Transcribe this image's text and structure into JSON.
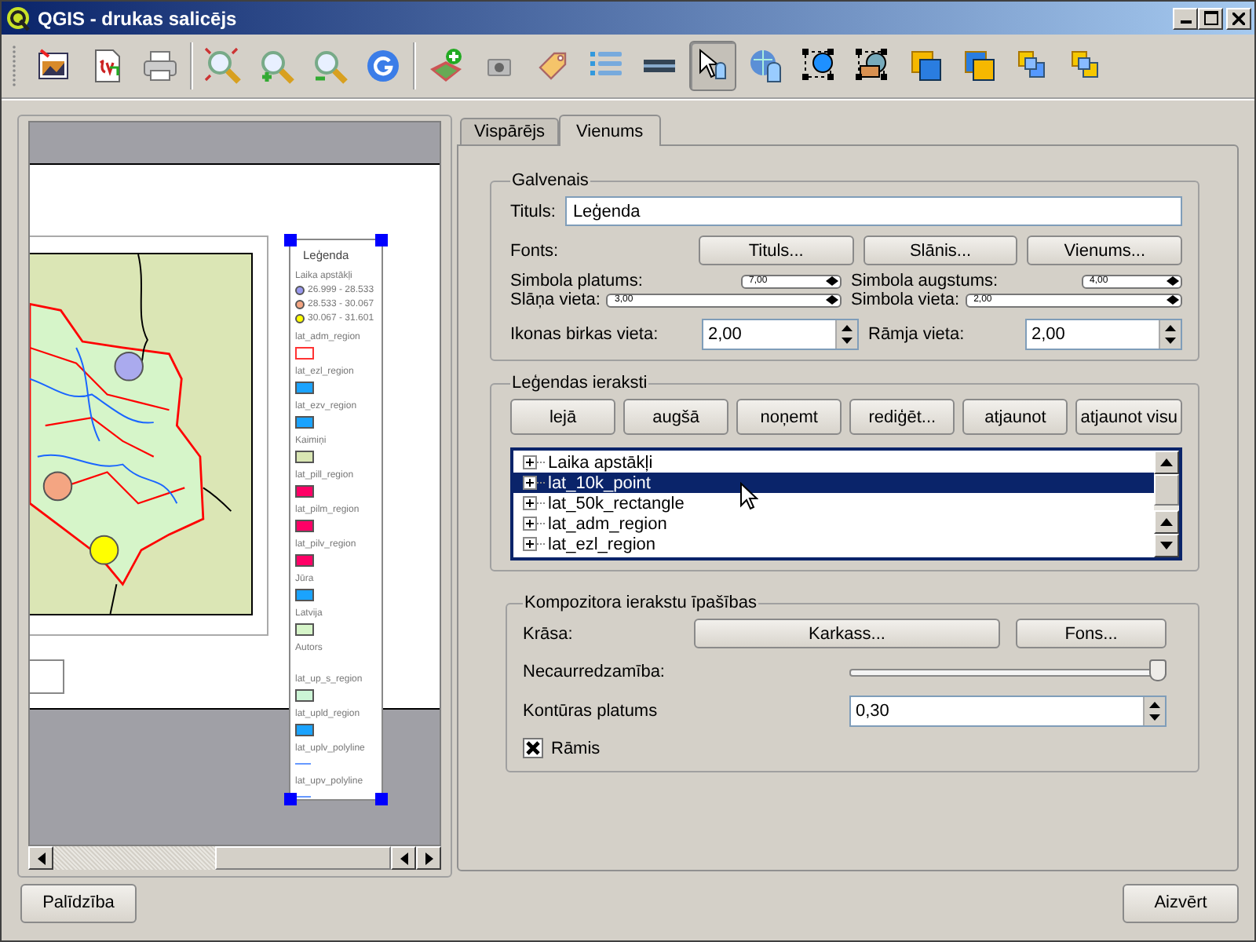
{
  "window": {
    "title": "QGIS - drukas salicējs"
  },
  "toolbar": [
    {
      "kind": "image",
      "selected": false
    },
    {
      "kind": "svg",
      "selected": false
    },
    {
      "kind": "print",
      "selected": false
    },
    {
      "kind": "zoomfull",
      "selected": false
    },
    {
      "kind": "zoomin",
      "selected": false
    },
    {
      "kind": "zoomout",
      "selected": false
    },
    {
      "kind": "refresh",
      "selected": false
    },
    {
      "kind": "addmap",
      "selected": false
    },
    {
      "kind": "camera",
      "selected": false
    },
    {
      "kind": "tag",
      "selected": false
    },
    {
      "kind": "list",
      "selected": false
    },
    {
      "kind": "scalebar",
      "selected": false
    },
    {
      "kind": "select",
      "selected": true
    },
    {
      "kind": "pan",
      "selected": false
    },
    {
      "kind": "shape",
      "selected": false
    },
    {
      "kind": "shape2",
      "selected": false
    },
    {
      "kind": "raise",
      "selected": false
    },
    {
      "kind": "lower",
      "selected": false
    },
    {
      "kind": "group",
      "selected": false
    },
    {
      "kind": "ungroup",
      "selected": false
    }
  ],
  "composer": {
    "legend": {
      "title": "Leģenda",
      "group": "Laika apstākļi",
      "classes": [
        {
          "label": "26.999 - 28.533",
          "color": "#9999ee"
        },
        {
          "label": "28.533 - 30.067",
          "color": "#f4a582"
        },
        {
          "label": "30.067 - 31.601",
          "color": "#ffff00"
        }
      ],
      "layers": [
        {
          "name": "lat_adm_region",
          "kind": "outline",
          "color": "#ff3333"
        },
        {
          "name": "lat_ezl_region",
          "kind": "fill",
          "color": "#1aa3ff"
        },
        {
          "name": "lat_ezv_region",
          "kind": "fill",
          "color": "#1aa3ff"
        },
        {
          "name": "Kaimiņi",
          "kind": "fill",
          "color": "#d9e6b3"
        },
        {
          "name": "lat_pill_region",
          "kind": "fill",
          "color": "#ff0066"
        },
        {
          "name": "lat_pilm_region",
          "kind": "fill",
          "color": "#ff0066"
        },
        {
          "name": "lat_pilv_region",
          "kind": "fill",
          "color": "#ff0066"
        },
        {
          "name": "Jūra",
          "kind": "fill",
          "color": "#1aa3ff"
        },
        {
          "name": "Latvija",
          "kind": "fill",
          "color": "#d6f5c9"
        },
        {
          "name": "Autors",
          "kind": "text"
        },
        {
          "name": "lat_up_s_region",
          "kind": "fill",
          "color": "#ccf5d6"
        },
        {
          "name": "lat_upld_region",
          "kind": "fill",
          "color": "#1aa3ff"
        },
        {
          "name": "lat_uplv_polyline",
          "kind": "line",
          "color": "#6699ff"
        },
        {
          "name": "lat_upv_polyline",
          "kind": "line",
          "color": "#6699ff"
        }
      ]
    }
  },
  "tabs": [
    {
      "label": "Vispārējs",
      "selected": false
    },
    {
      "label": "Vienums",
      "selected": true
    }
  ],
  "main_group": {
    "title": "Galvenais",
    "title_label": "Tituls:",
    "title_value": "Leģenda",
    "fonts_label": "Fonts:",
    "font_buttons": [
      "Tituls...",
      "Slānis...",
      "Vienums..."
    ],
    "small_spins": [
      {
        "label": "Simbola platums:",
        "value": "7,00"
      },
      {
        "label": "Simbola augstums:",
        "value": "4,00"
      },
      {
        "label": "Slāņa vieta:",
        "value": "3,00"
      },
      {
        "label": "Simbola vieta:",
        "value": "2,00"
      }
    ],
    "spins": [
      {
        "label": "Ikonas birkas vieta:",
        "value": "2,00"
      },
      {
        "label": "Rāmja vieta:",
        "value": "2,00"
      }
    ]
  },
  "entries_group": {
    "title": "Leģendas ieraksti",
    "buttons": [
      "lejā",
      "augšā",
      "noņemt",
      "rediģēt...",
      "atjaunot",
      "atjaunot visu"
    ],
    "tree": [
      {
        "label": "Laika apstākļi",
        "selected": false,
        "expanded": false
      },
      {
        "label": "lat_10k_point",
        "selected": true,
        "expanded": false
      },
      {
        "label": "lat_50k_rectangle",
        "selected": false,
        "expanded": false
      },
      {
        "label": "lat_adm_region",
        "selected": false,
        "expanded": false
      },
      {
        "label": "lat_ezl_region",
        "selected": false,
        "expanded": false
      }
    ]
  },
  "item_group": {
    "title": "Kompozitora ierakstu īpašības",
    "color_label": "Krāsa:",
    "color_buttons": [
      "Karkass...",
      "Fons..."
    ],
    "opacity_label": "Necaurredzamība:",
    "opacity": {
      "level": 1
    },
    "outline_label": "Kontūras platums",
    "outline_value": "0,30",
    "frame": {
      "label": "Rāmis",
      "checked": true
    }
  },
  "buttons": {
    "help": "Palīdzība",
    "close": "Aizvērt"
  }
}
